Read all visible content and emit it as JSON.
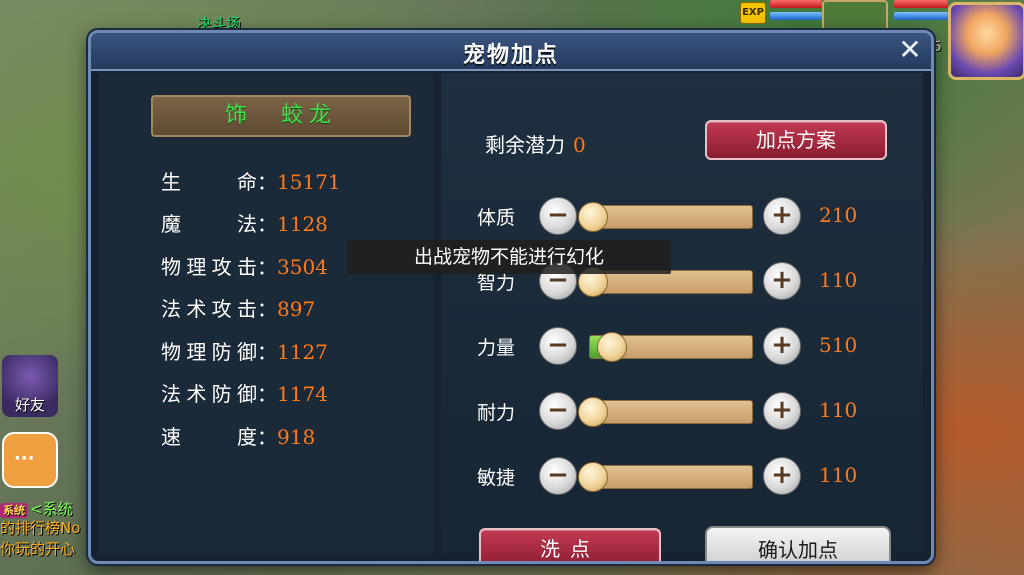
{
  "background": {
    "scene_label": "决斗场",
    "exp_badge": "EXP",
    "level_text": "55",
    "friend_label": "好友",
    "chat_icon": "···",
    "chat_lines": [
      {
        "tag": "系统",
        "text": "<系统"
      },
      {
        "text": "的排行榜No"
      },
      {
        "text": "你玩的开心"
      }
    ]
  },
  "dialog": {
    "title": "宠物加点",
    "close_glyph": "✕"
  },
  "pet": {
    "name": "饰　蛟龙"
  },
  "stats": [
    {
      "label": "生命",
      "value": "15171"
    },
    {
      "label": "魔法",
      "value": "1128"
    },
    {
      "label": "物理攻击",
      "value": "3504"
    },
    {
      "label": "法术攻击",
      "value": "897"
    },
    {
      "label": "物理防御",
      "value": "1127"
    },
    {
      "label": "法术防御",
      "value": "1174"
    },
    {
      "label": "速度",
      "value": "918"
    }
  ],
  "colon": "：",
  "remaining": {
    "label": "剩余潜力",
    "value": "0"
  },
  "plan_button": "加点方案",
  "attributes": [
    {
      "label": "体质",
      "value": "210",
      "fill": 0.0
    },
    {
      "label": "智力",
      "value": "110",
      "fill": 0.0
    },
    {
      "label": "力量",
      "value": "510",
      "fill": 0.12
    },
    {
      "label": "耐力",
      "value": "110",
      "fill": 0.0
    },
    {
      "label": "敏捷",
      "value": "110",
      "fill": 0.0
    }
  ],
  "minus_glyph": "−",
  "plus_glyph": "+",
  "wash_button": "洗点",
  "confirm_button": "确认加点",
  "toast": "出战宠物不能进行幻化",
  "colors": {
    "value_orange": "#ff7a1a",
    "pet_name_green": "#3ee24a",
    "button_red": "#a82a40",
    "slider_green": "#6ac23a"
  }
}
